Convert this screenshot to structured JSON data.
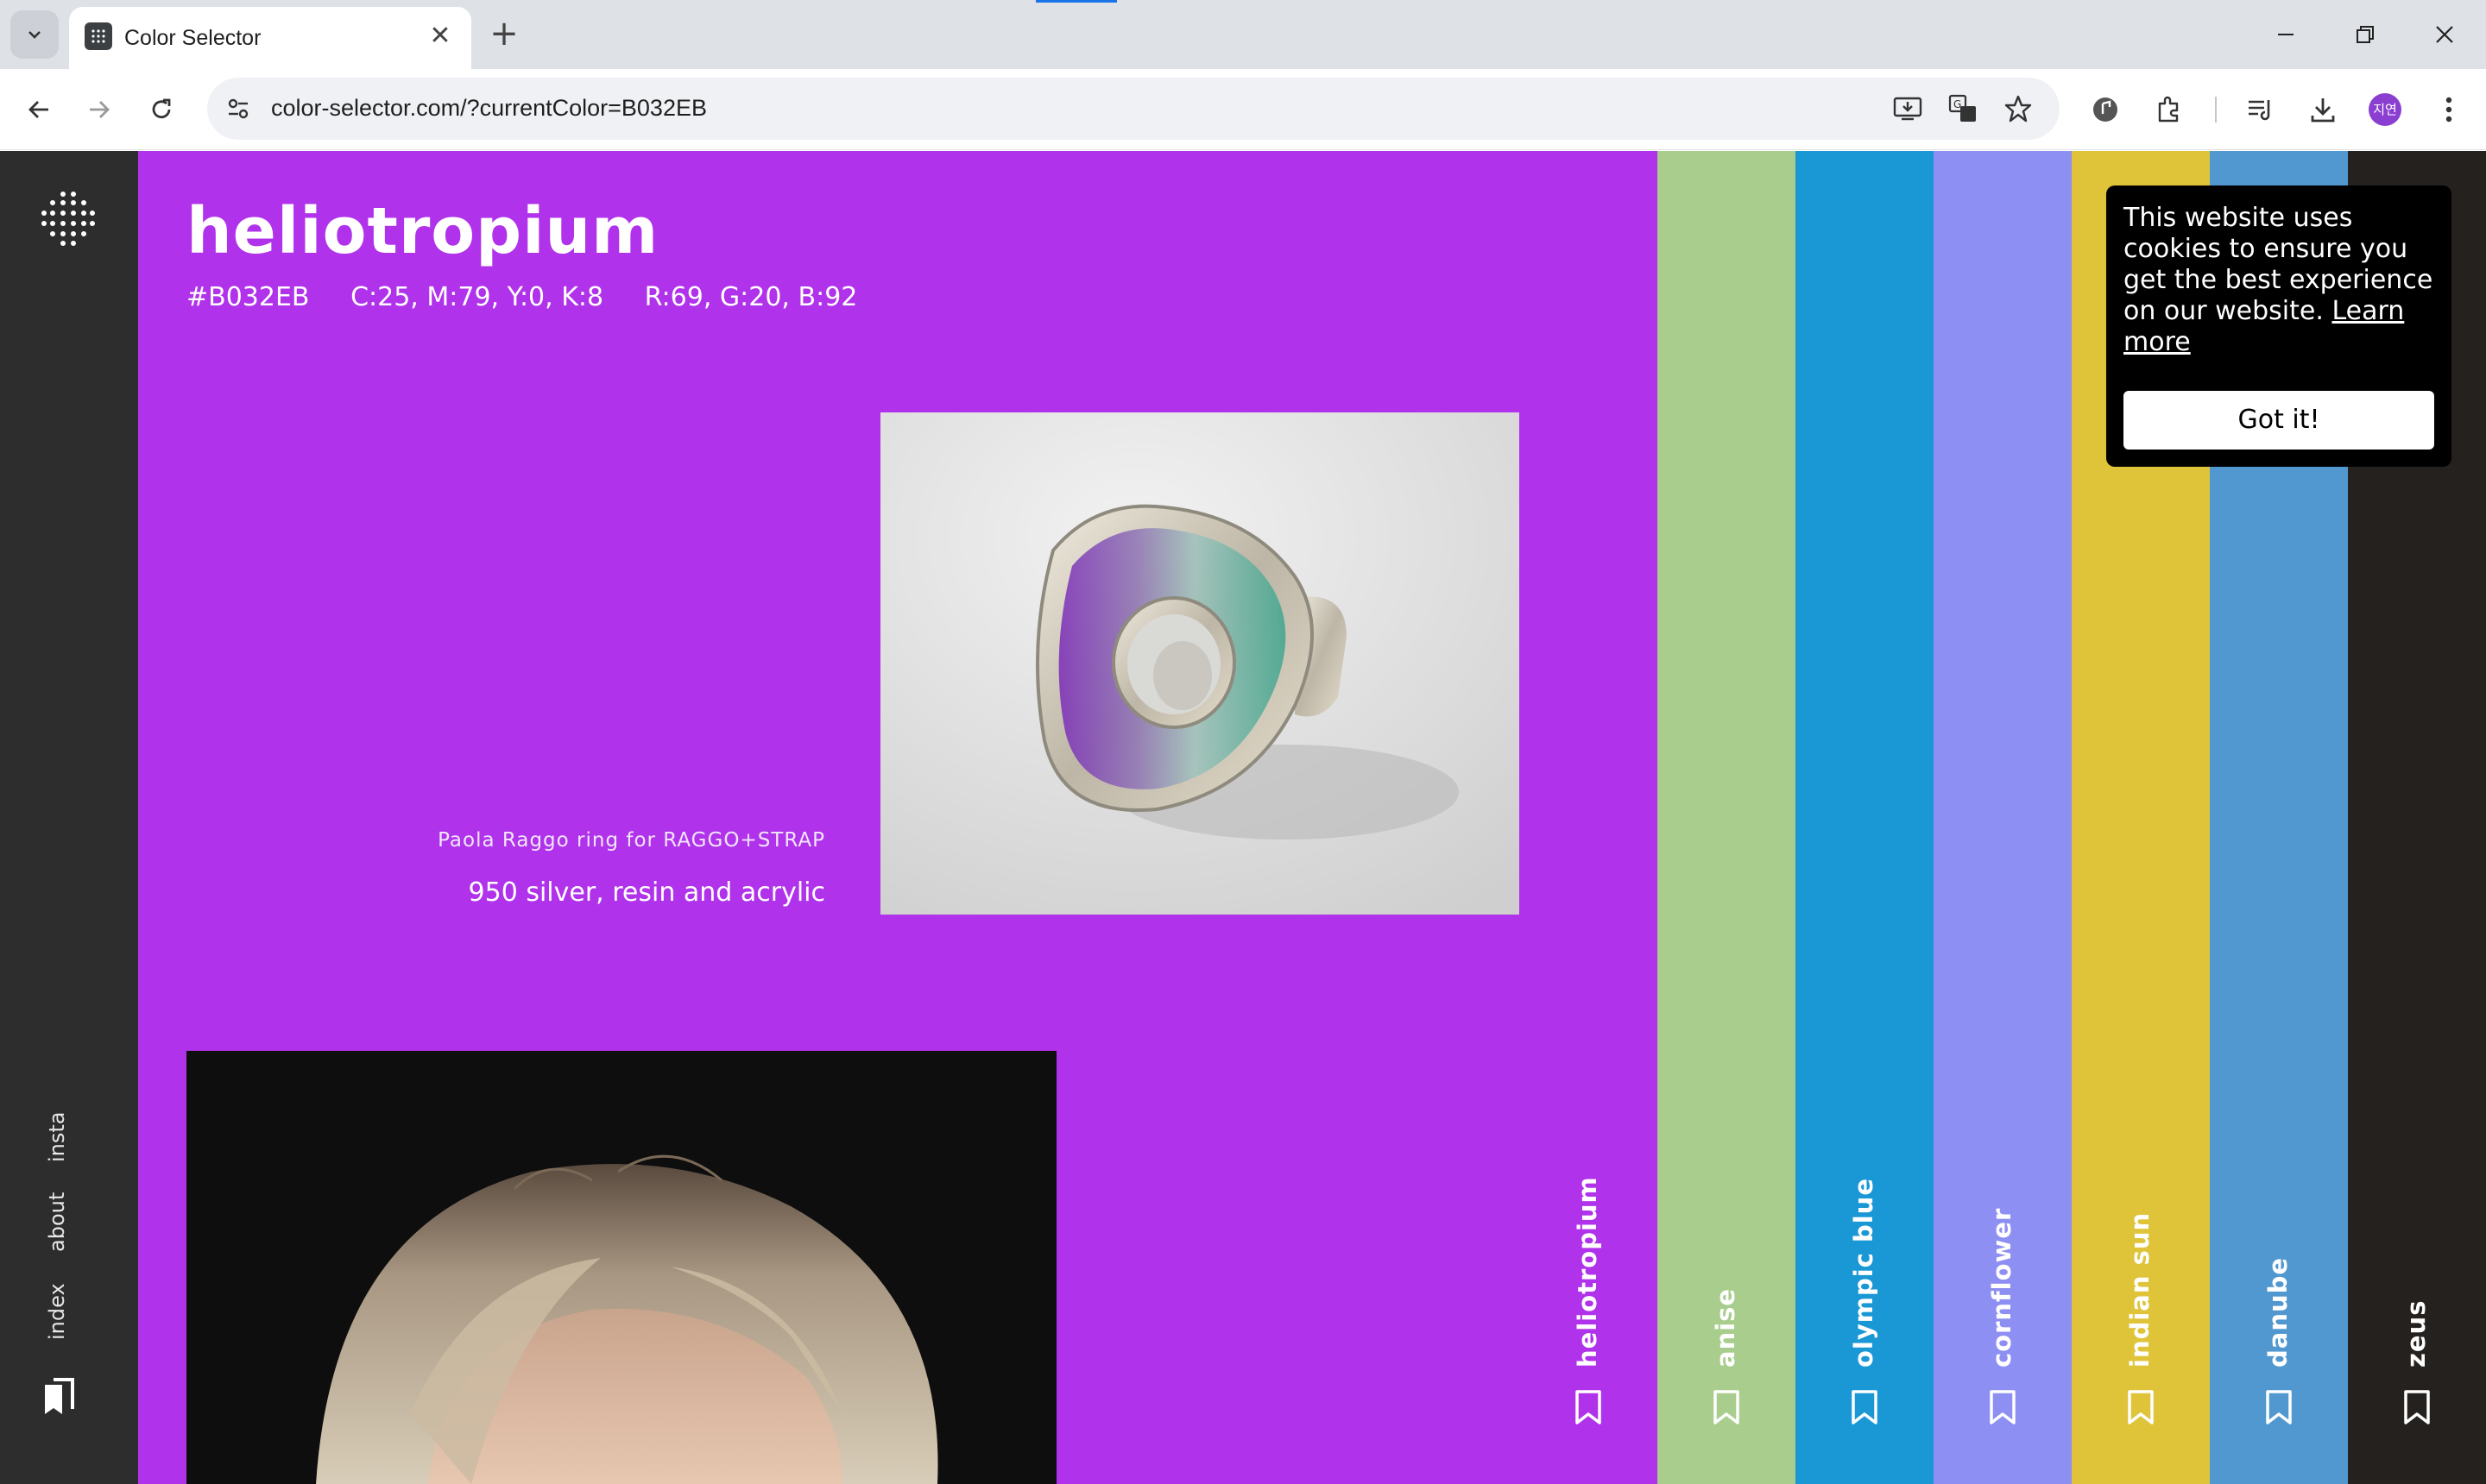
{
  "browser": {
    "tab_title": "Color Selector",
    "url": "color-selector.com/?currentColor=B032EB",
    "profile_initials": "지연"
  },
  "sidebar": {
    "links": [
      {
        "label": "insta"
      },
      {
        "label": "about"
      },
      {
        "label": "index"
      }
    ]
  },
  "color": {
    "name": "heliotropium",
    "hex": "#B032EB",
    "cmyk": "C:25, M:79, Y:0, K:8",
    "rgb": "R:69, G:20, B:92",
    "background": "#b032eb"
  },
  "gallery": {
    "caption_credit": "Paola Raggo ring for RAGGO+STRAP",
    "caption_material": "950 silver, resin and acrylic"
  },
  "strips": [
    {
      "name": "heliotropium",
      "color": "#b032eb"
    },
    {
      "name": "anise",
      "color": "#a8cd8c"
    },
    {
      "name": "olympic blue",
      "color": "#1a97d5"
    },
    {
      "name": "cornflower",
      "color": "#8d8ff2"
    },
    {
      "name": "indian sun",
      "color": "#dfc43a"
    },
    {
      "name": "danube",
      "color": "#5098cf"
    },
    {
      "name": "zeus",
      "color": "#24211e"
    }
  ],
  "cookie": {
    "message": "This website uses cookies to ensure you get the best experience on our website.",
    "link": "Learn more",
    "button": "Got it!"
  }
}
